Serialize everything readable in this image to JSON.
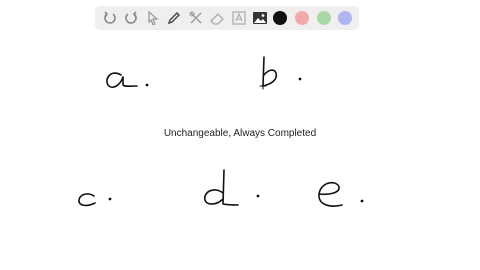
{
  "toolbar": {
    "tools": [
      {
        "icon": "undo-icon"
      },
      {
        "icon": "redo-icon"
      },
      {
        "icon": "pointer-icon"
      },
      {
        "icon": "pen-icon"
      },
      {
        "icon": "tools-icon"
      },
      {
        "icon": "eraser-icon"
      },
      {
        "icon": "text-icon"
      },
      {
        "icon": "image-icon"
      }
    ],
    "colors": [
      "#111111",
      "#f2a9a9",
      "#a8d8a8",
      "#b0b4f0"
    ]
  },
  "whiteboard": {
    "caption": "Unchangeable, Always Completed",
    "handwritten_letters": [
      "a",
      "b",
      "c",
      "d",
      "e"
    ]
  }
}
